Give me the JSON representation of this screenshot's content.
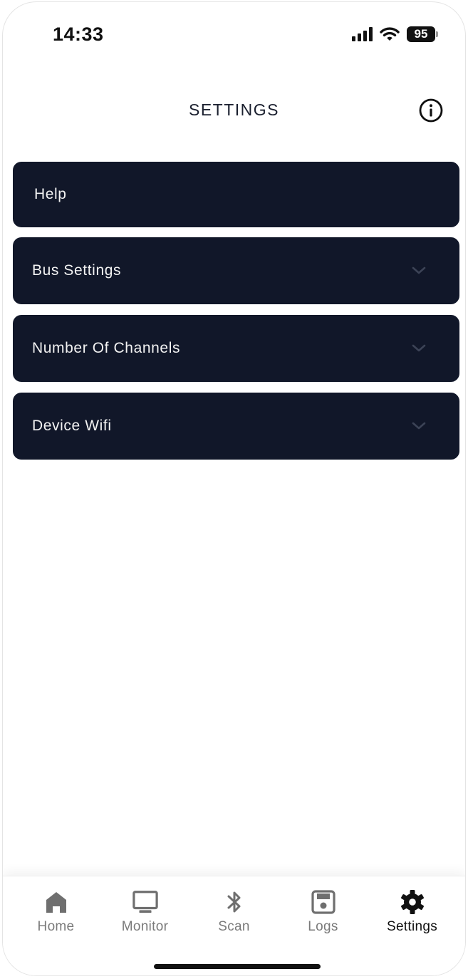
{
  "status_bar": {
    "time": "14:33",
    "battery": "95",
    "icons": [
      "signal-icon",
      "wifi-icon",
      "battery-icon"
    ]
  },
  "header": {
    "title": "SETTINGS",
    "info_icon": "info-icon"
  },
  "settings": {
    "items": [
      {
        "label": "Help",
        "expandable": false
      },
      {
        "label": "Bus Settings",
        "expandable": true
      },
      {
        "label": "Number Of Channels",
        "expandable": true
      },
      {
        "label": "Device Wifi",
        "expandable": true
      }
    ]
  },
  "tab_bar": {
    "tabs": [
      {
        "label": "Home",
        "icon": "home-icon",
        "active": false
      },
      {
        "label": "Monitor",
        "icon": "monitor-icon",
        "active": false
      },
      {
        "label": "Scan",
        "icon": "bluetooth-icon",
        "active": false
      },
      {
        "label": "Logs",
        "icon": "save-icon",
        "active": false
      },
      {
        "label": "Settings",
        "icon": "gear-icon",
        "active": true
      }
    ]
  },
  "colors": {
    "item_background": "#111729",
    "item_text": "#f2f2f2",
    "tab_inactive": "#7a7a7a",
    "tab_active": "#111111"
  }
}
